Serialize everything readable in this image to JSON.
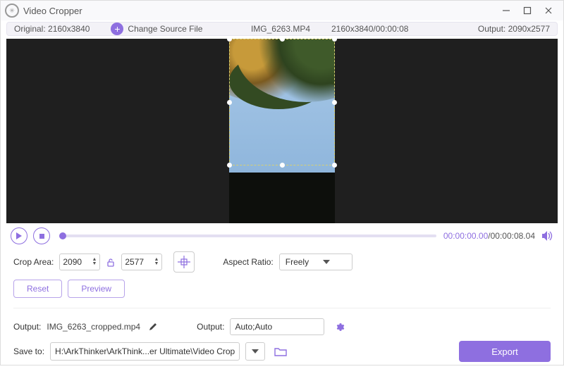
{
  "title": "Video Cropper",
  "infoBar": {
    "originalLabel": "Original:",
    "originalValue": "2160x3840",
    "changeSource": "Change Source File",
    "filename": "IMG_6263.MP4",
    "dims_dur": "2160x3840/00:00:08",
    "outputLabel": "Output:",
    "outputValue": "2090x2577"
  },
  "time": {
    "current": "00:00:00.00",
    "total": "/00:00:08.04"
  },
  "crop": {
    "areaLabel": "Crop Area:",
    "w": "2090",
    "h": "2577",
    "aspectLabel": "Aspect Ratio:",
    "aspectValue": "Freely"
  },
  "buttons": {
    "reset": "Reset",
    "preview": "Preview",
    "export": "Export"
  },
  "output": {
    "fileLabel": "Output:",
    "fileName": "IMG_6263_cropped.mp4",
    "fmtLabel": "Output:",
    "fmtValue": "Auto;Auto"
  },
  "save": {
    "label": "Save to:",
    "path": "H:\\ArkThinker\\ArkThink...er Ultimate\\Video Crop"
  }
}
